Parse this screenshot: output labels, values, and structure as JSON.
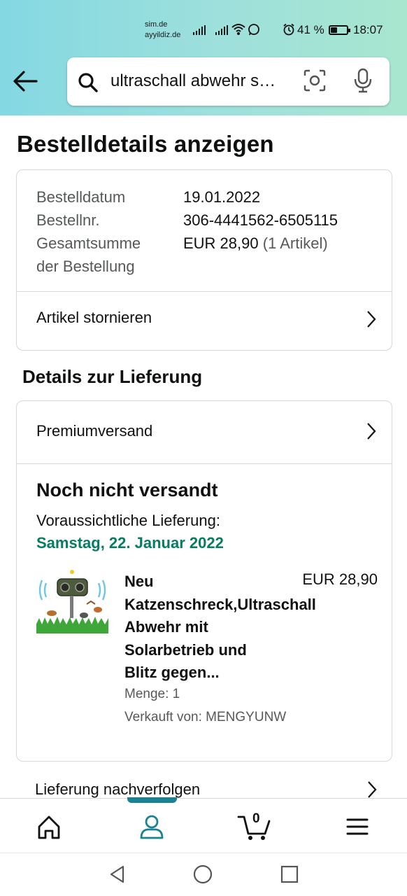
{
  "status_bar": {
    "carrier_line1": "sim.de",
    "carrier_line2": "ayyildiz.de",
    "battery": "41 %",
    "battery_level": 0.41,
    "time": "18:07"
  },
  "search": {
    "query": "ultraschall abwehr s…",
    "icons": [
      "back-arrow-icon",
      "search-icon",
      "camera-scan-icon",
      "microphone-icon"
    ]
  },
  "page": {
    "title": "Bestelldetails anzeigen"
  },
  "order_summary": {
    "date_label": "Bestelldatum",
    "date_value": "19.01.2022",
    "number_label": "Bestellnr.",
    "number_value": "306-4441562-6505115",
    "total_label_line1": "Gesamtsumme",
    "total_label_line2": "der Bestellung",
    "total_value": "EUR 28,90",
    "total_items": "(1 Artikel)",
    "cancel_link": "Artikel stornieren"
  },
  "delivery": {
    "section_title": "Details zur Lieferung",
    "shipping_method": "Premiumversand",
    "status": "Noch nicht versandt",
    "eta_label": "Voraussichtliche Lieferung:",
    "eta_date": "Samstag, 22. Januar 2022",
    "accent_color": "#067d62"
  },
  "product": {
    "title_lines": [
      "Neu",
      "Katzenschreck,Ultraschall",
      "Abwehr mit",
      "Solarbetrieb und",
      "Blitz gegen..."
    ],
    "price": "EUR 28,90",
    "quantity": "Menge: 1",
    "seller": "Verkauft von: MENGYUNW"
  },
  "track_link": "Lieferung nachverfolgen",
  "bottom_nav": {
    "items": [
      "home-icon",
      "account-icon",
      "cart-icon",
      "menu-icon"
    ],
    "cart_count": "0",
    "active_color": "#1a8391"
  },
  "system_nav": [
    "back-triangle-icon",
    "home-circle-icon",
    "recents-square-icon"
  ]
}
